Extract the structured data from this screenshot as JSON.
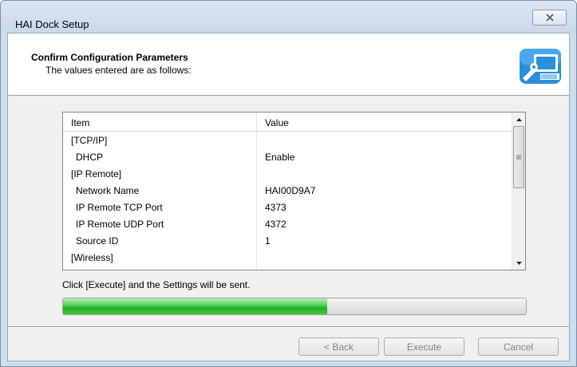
{
  "window": {
    "title": "HAI Dock Setup"
  },
  "header": {
    "title": "Confirm Configuration Parameters",
    "subtitle": "The values entered are as follows:",
    "icon": "computer-config-icon"
  },
  "table": {
    "columns": [
      "Item",
      "Value"
    ],
    "rows": [
      {
        "item": "[TCP/IP]",
        "value": "",
        "indent": false
      },
      {
        "item": "DHCP",
        "value": "Enable",
        "indent": true
      },
      {
        "item": "[IP Remote]",
        "value": "",
        "indent": false
      },
      {
        "item": "Network Name",
        "value": "HAI00D9A7",
        "indent": true
      },
      {
        "item": "IP Remote TCP Port",
        "value": "4373",
        "indent": true
      },
      {
        "item": "IP Remote UDP Port",
        "value": "4372",
        "indent": true
      },
      {
        "item": "Source ID",
        "value": "1",
        "indent": true
      },
      {
        "item": "[Wireless]",
        "value": "",
        "indent": false
      }
    ]
  },
  "status": {
    "message": "Click [Execute] and the Settings will be sent."
  },
  "progress": {
    "fraction": 0.57
  },
  "buttons": {
    "back": "< Back",
    "execute": "Execute",
    "cancel": "Cancel"
  },
  "colors": {
    "progress_green": "#23b023",
    "window_frame": "#cfdcec"
  }
}
